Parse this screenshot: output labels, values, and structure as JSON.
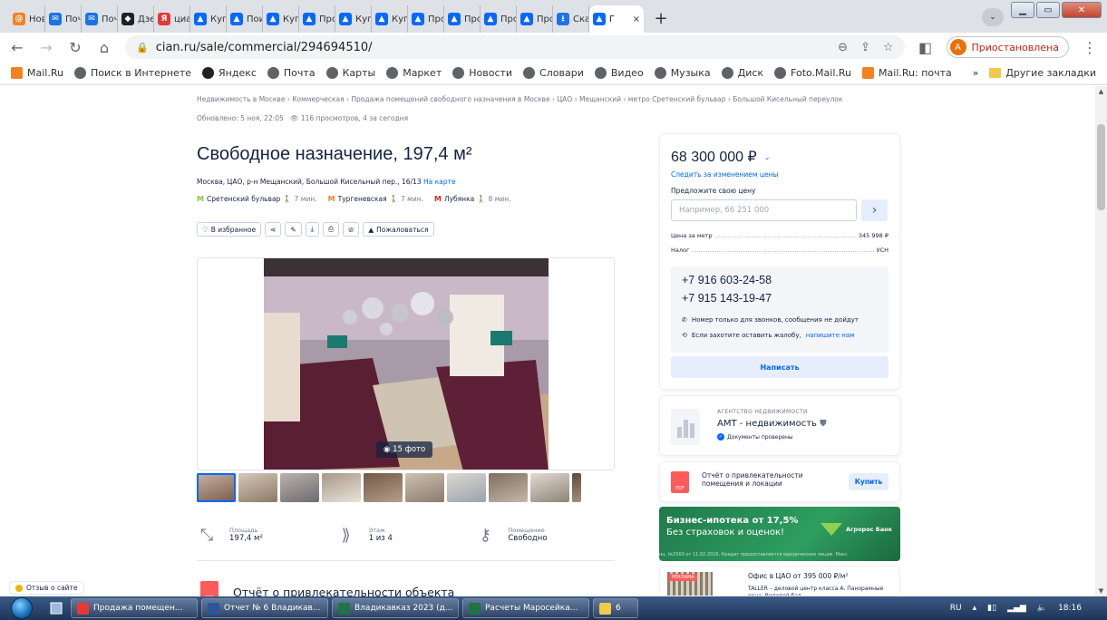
{
  "browser": {
    "tabs": [
      {
        "label": "Нов",
        "color": "#f48120",
        "glyph": "@"
      },
      {
        "label": "Почт",
        "color": "#1a73e8",
        "glyph": "✉"
      },
      {
        "label": "Почт",
        "color": "#1a73e8",
        "glyph": "✉"
      },
      {
        "label": "Дзен",
        "color": "#202124",
        "glyph": "◆"
      },
      {
        "label": "циан",
        "color": "#e53935",
        "glyph": "Я"
      },
      {
        "label": "Купи",
        "color": "#0468ff",
        "glyph": "▲"
      },
      {
        "label": "Пои",
        "color": "#0468ff",
        "glyph": "▲"
      },
      {
        "label": "Купи",
        "color": "#0468ff",
        "glyph": "▲"
      },
      {
        "label": "Про",
        "color": "#0468ff",
        "glyph": "▲"
      },
      {
        "label": "Купи",
        "color": "#0468ff",
        "glyph": "▲"
      },
      {
        "label": "Купи",
        "color": "#0468ff",
        "glyph": "▲"
      },
      {
        "label": "Про",
        "color": "#0468ff",
        "glyph": "▲"
      },
      {
        "label": "Про",
        "color": "#0468ff",
        "glyph": "▲"
      },
      {
        "label": "Про",
        "color": "#0468ff",
        "glyph": "▲"
      },
      {
        "label": "Про",
        "color": "#0468ff",
        "glyph": "▲"
      },
      {
        "label": "Скач",
        "color": "#1a73e8",
        "glyph": "⭳"
      }
    ],
    "active_tab": {
      "label": "Г",
      "glyph": "▲",
      "close": "×"
    },
    "newtab": "+",
    "url": "cian.ru/sale/commercial/294694510/",
    "profile_initial": "A",
    "profile_label": "Приостановлена",
    "bookmarks": [
      {
        "label": "Mail.Ru",
        "icon": "mail"
      },
      {
        "label": "Поиск в Интернете",
        "icon": "globe"
      },
      {
        "label": "Яндекс",
        "icon": "ya"
      },
      {
        "label": "Почта",
        "icon": "globe"
      },
      {
        "label": "Карты",
        "icon": "globe"
      },
      {
        "label": "Маркет",
        "icon": "globe"
      },
      {
        "label": "Новости",
        "icon": "globe"
      },
      {
        "label": "Словари",
        "icon": "globe"
      },
      {
        "label": "Видео",
        "icon": "globe"
      },
      {
        "label": "Музыка",
        "icon": "globe"
      },
      {
        "label": "Диск",
        "icon": "globe"
      },
      {
        "label": "Foto.Mail.Ru",
        "icon": "globe"
      },
      {
        "label": "Mail.Ru: почта",
        "icon": "mail"
      }
    ],
    "bookmarks_more": "»",
    "other_bookmarks": "Другие закладки"
  },
  "page": {
    "breadcrumbs": "Недвижимость в Москве › Коммерческая › Продажа помещений свободного назначения в Москве › ЦАО › Мещанский › метро Сретенский бульвар › Большой Кисельный переулок",
    "updated": "Обновлено: 5 ноя, 22:05",
    "views": "116 просмотров, 4 за сегодня",
    "title": "Свободное назначение, 197,4 м²",
    "address": "Москва, ЦАО, р-н Мещанский, Большой Кисельный пер., 16/13",
    "map_link": "На карте",
    "metro": [
      {
        "name": "Сретенский бульвар",
        "walk": "7 мин.",
        "color": "#8ac43f"
      },
      {
        "name": "Тургеневская",
        "walk": "7 мин.",
        "color": "#f58220"
      },
      {
        "name": "Лубянка",
        "walk": "8 мин.",
        "color": "#e4261e"
      }
    ],
    "actions": {
      "favorite": "В избранное",
      "complain": "Пожаловаться"
    },
    "photo_count": "15 фото",
    "facts": [
      {
        "label": "Площадь",
        "value": "197,4 м²"
      },
      {
        "label": "Этаж",
        "value": "1 из 4"
      },
      {
        "label": "Помещение",
        "value": "Свободно"
      }
    ],
    "report_title": "Отчёт о привлекательности объекта",
    "feedback": "Отзыв о сайте"
  },
  "sidebar": {
    "price": "68 300 000 ₽",
    "follow_price": "Следить за изменением цены",
    "offer_label": "Предложите свою цену",
    "offer_placeholder": "Например, 66 251 000",
    "price_per_meter_label": "Цена за метр",
    "price_per_meter": "345 998 ₽",
    "tax_label": "Налог",
    "tax": "УСН",
    "phones": [
      "+7 916 603-24-58",
      "+7 915 143-19-47"
    ],
    "calls_only": "Номер только для звонков, сообщения не дойдут",
    "complaint_text": "Если захотите оставить жалобу,",
    "complaint_link": "напишите нам",
    "write_button": "Написать",
    "agency_type": "АГЕНТСТВО НЕДВИЖИМОСТИ",
    "agency_name": "АМТ - недвижимость",
    "agency_docs": "Документы проверены",
    "report_card": "Отчёт о привлекательности помещения и локации",
    "buy_button": "Купить",
    "banner_line1": "Бизнес-ипотека от 17,5%",
    "banner_line2": "Без страховок и оценок!",
    "banner_bank": "Агророс Банк",
    "banner_fine": "нц. №2560 от 11.02.2016. Кредит предоставляется юридическим лицам. Макс",
    "ad_tag": "РЕКЛАМА",
    "ad_title": "Офис в ЦАО от 395 000 ₽/м²",
    "ad_text": "TALLER – деловой центр класса А. Панорамные окна. Видовой бал"
  },
  "taskbar": {
    "items": [
      {
        "label": "Продажа помещен...",
        "color": "#e53935"
      },
      {
        "label": "Отчет № 6 Владикав...",
        "color": "#2b579a"
      },
      {
        "label": "Владикавказ 2023 (д...",
        "color": "#217346"
      },
      {
        "label": "Расчеты Маросейка...",
        "color": "#217346"
      },
      {
        "label": "6",
        "color": "#f2c94c"
      }
    ],
    "lang": "RU",
    "time": "18:16"
  }
}
